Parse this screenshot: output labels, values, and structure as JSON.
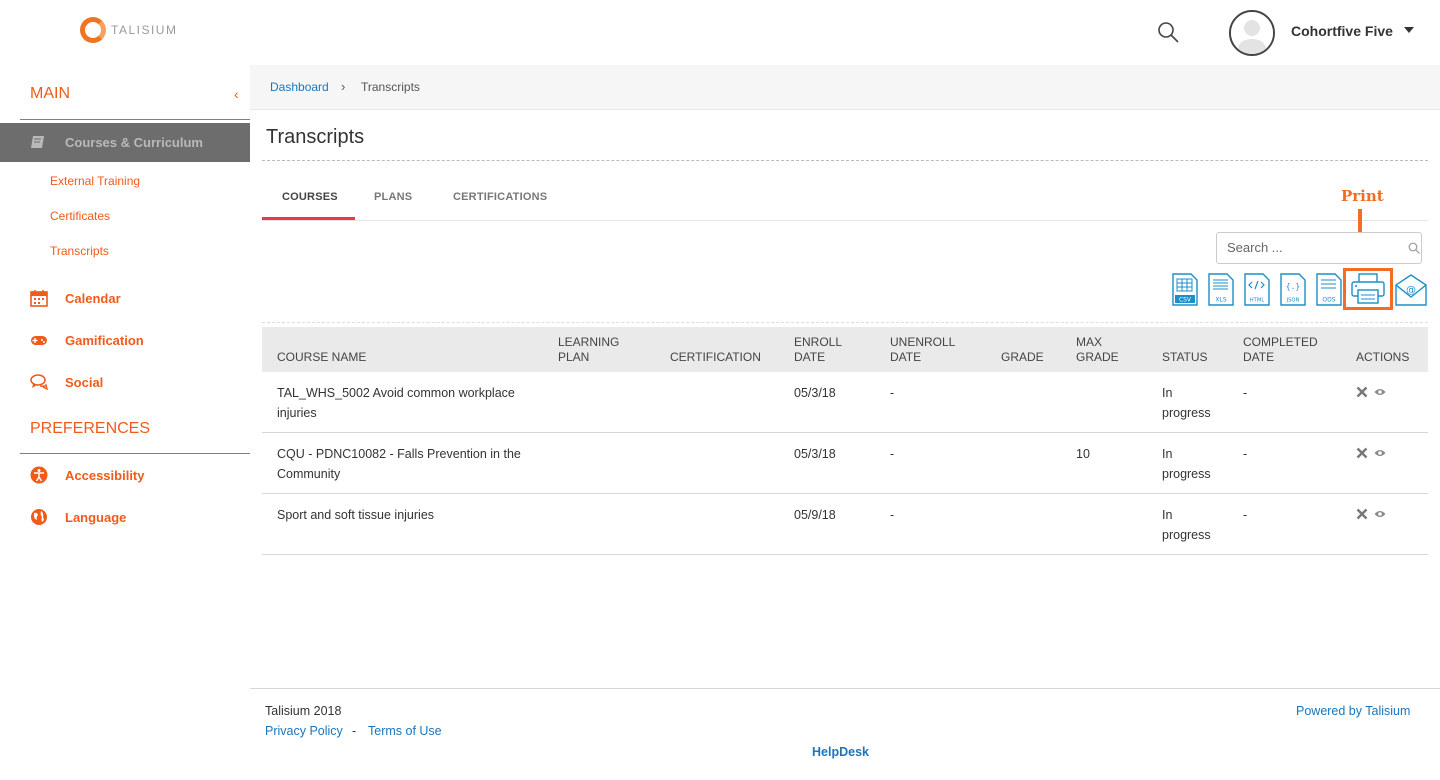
{
  "header": {
    "logo_text": "TALISIUM",
    "user_name": "Cohortfive Five",
    "icons": [
      "search-icon",
      "user-avatar",
      "caret-down-icon"
    ]
  },
  "sidebar": {
    "main_title": "MAIN",
    "active_item": {
      "label": "Courses & Curriculum",
      "icon": "book-icon"
    },
    "sub_items": [
      {
        "label": "External Training"
      },
      {
        "label": "Certificates"
      },
      {
        "label": "Transcripts"
      }
    ],
    "nav_items": [
      {
        "label": "Calendar",
        "icon": "calendar-icon"
      },
      {
        "label": "Gamification",
        "icon": "gamepad-icon"
      },
      {
        "label": "Social",
        "icon": "chat-icon"
      }
    ],
    "preferences_title": "PREFERENCES",
    "pref_items": [
      {
        "label": "Accessibility",
        "icon": "accessibility-icon"
      },
      {
        "label": "Language",
        "icon": "globe-icon"
      }
    ]
  },
  "breadcrumb": {
    "home": "Dashboard",
    "current": "Transcripts"
  },
  "page": {
    "title": "Transcripts"
  },
  "tabs": [
    {
      "label": "COURSES",
      "active": true
    },
    {
      "label": "PLANS",
      "active": false
    },
    {
      "label": "CERTIFICATIONS",
      "active": false
    }
  ],
  "annotation": {
    "label": "Print",
    "color": "#f36c21"
  },
  "search": {
    "placeholder": "Search ..."
  },
  "exports": [
    {
      "label": "CSV",
      "icon": "csv-file-icon"
    },
    {
      "label": "XLS",
      "icon": "xls-file-icon"
    },
    {
      "label": "HTML",
      "icon": "html-file-icon"
    },
    {
      "label": "JSON",
      "icon": "json-file-icon"
    },
    {
      "label": "ODS",
      "icon": "ods-file-icon"
    }
  ],
  "table": {
    "columns": [
      {
        "line1": "",
        "line2": "COURSE NAME"
      },
      {
        "line1": "LEARNING",
        "line2": "PLAN"
      },
      {
        "line1": "",
        "line2": "CERTIFICATION"
      },
      {
        "line1": "ENROLL",
        "line2": "DATE"
      },
      {
        "line1": "UNENROLL",
        "line2": "DATE"
      },
      {
        "line1": "",
        "line2": "GRADE"
      },
      {
        "line1": "MAX",
        "line2": "GRADE"
      },
      {
        "line1": "",
        "line2": "STATUS"
      },
      {
        "line1": "COMPLETED",
        "line2": "DATE"
      },
      {
        "line1": "",
        "line2": "ACTIONS"
      }
    ],
    "rows": [
      {
        "course_line1": "TAL_WHS_5002 Avoid common workplace",
        "course_line2": "injuries",
        "learning_plan": "",
        "certification": "",
        "enroll_date": "05/3/18",
        "unenroll_date": "-",
        "grade": "",
        "max_grade": "",
        "status_line1": "In",
        "status_line2": "progress",
        "completed_date": "-"
      },
      {
        "course_line1": "CQU - PDNC10082 - Falls Prevention in the",
        "course_line2": "Community",
        "learning_plan": "",
        "certification": "",
        "enroll_date": "05/3/18",
        "unenroll_date": "-",
        "grade": "",
        "max_grade": "10",
        "status_line1": "In",
        "status_line2": "progress",
        "completed_date": "-"
      },
      {
        "course_line1": "Sport and soft tissue injuries",
        "course_line2": "",
        "learning_plan": "",
        "certification": "",
        "enroll_date": "05/9/18",
        "unenroll_date": "-",
        "grade": "",
        "max_grade": "",
        "status_line1": "In",
        "status_line2": "progress",
        "completed_date": "-"
      }
    ]
  },
  "footer": {
    "copyright": "Talisium 2018",
    "privacy": "Privacy Policy",
    "separator": "-",
    "terms": "Terms of Use",
    "powered": "Powered by Talisium",
    "helpdesk": "HelpDesk"
  },
  "colors": {
    "accent": "#f05a1a",
    "link": "#1b75bb",
    "tab_active": "#e53b48",
    "icon_blue": "#1a8fc9"
  }
}
